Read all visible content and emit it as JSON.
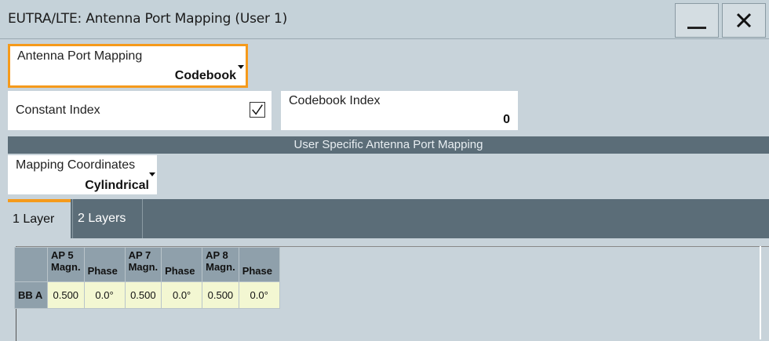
{
  "window": {
    "title": "EUTRA/LTE: Antenna Port Mapping (User 1)",
    "minimize_label": "minimize",
    "close_label": "close"
  },
  "antenna_port_mapping": {
    "label": "Antenna Port Mapping",
    "value": "Codebook"
  },
  "constant_index": {
    "label": "Constant Index",
    "checked": true
  },
  "codebook_index": {
    "label": "Codebook Index",
    "value": "0"
  },
  "section_title": "User Specific Antenna Port Mapping",
  "mapping_coordinates": {
    "label": "Mapping Coordinates",
    "value": "Cylindrical"
  },
  "tabs": [
    {
      "label": "1 Layer",
      "active": true
    },
    {
      "label": "2 Layers",
      "active": false
    }
  ],
  "table": {
    "columns": [
      {
        "ap": "AP 5",
        "sub": "Magn."
      },
      {
        "ap": "",
        "sub": "Phase"
      },
      {
        "ap": "AP 7",
        "sub": "Magn."
      },
      {
        "ap": "",
        "sub": "Phase"
      },
      {
        "ap": "AP 8",
        "sub": "Magn."
      },
      {
        "ap": "",
        "sub": "Phase"
      }
    ],
    "rows": [
      {
        "label": "BB A",
        "values": [
          "0.500",
          "0.0°",
          "0.500",
          "0.0°",
          "0.500",
          "0.0°"
        ]
      }
    ]
  },
  "colors": {
    "focus_accent": "#f59a1b",
    "section_bar": "#5b6d78",
    "cell_bg": "#f3f7d2",
    "header_bg": "#8fa0ab"
  }
}
